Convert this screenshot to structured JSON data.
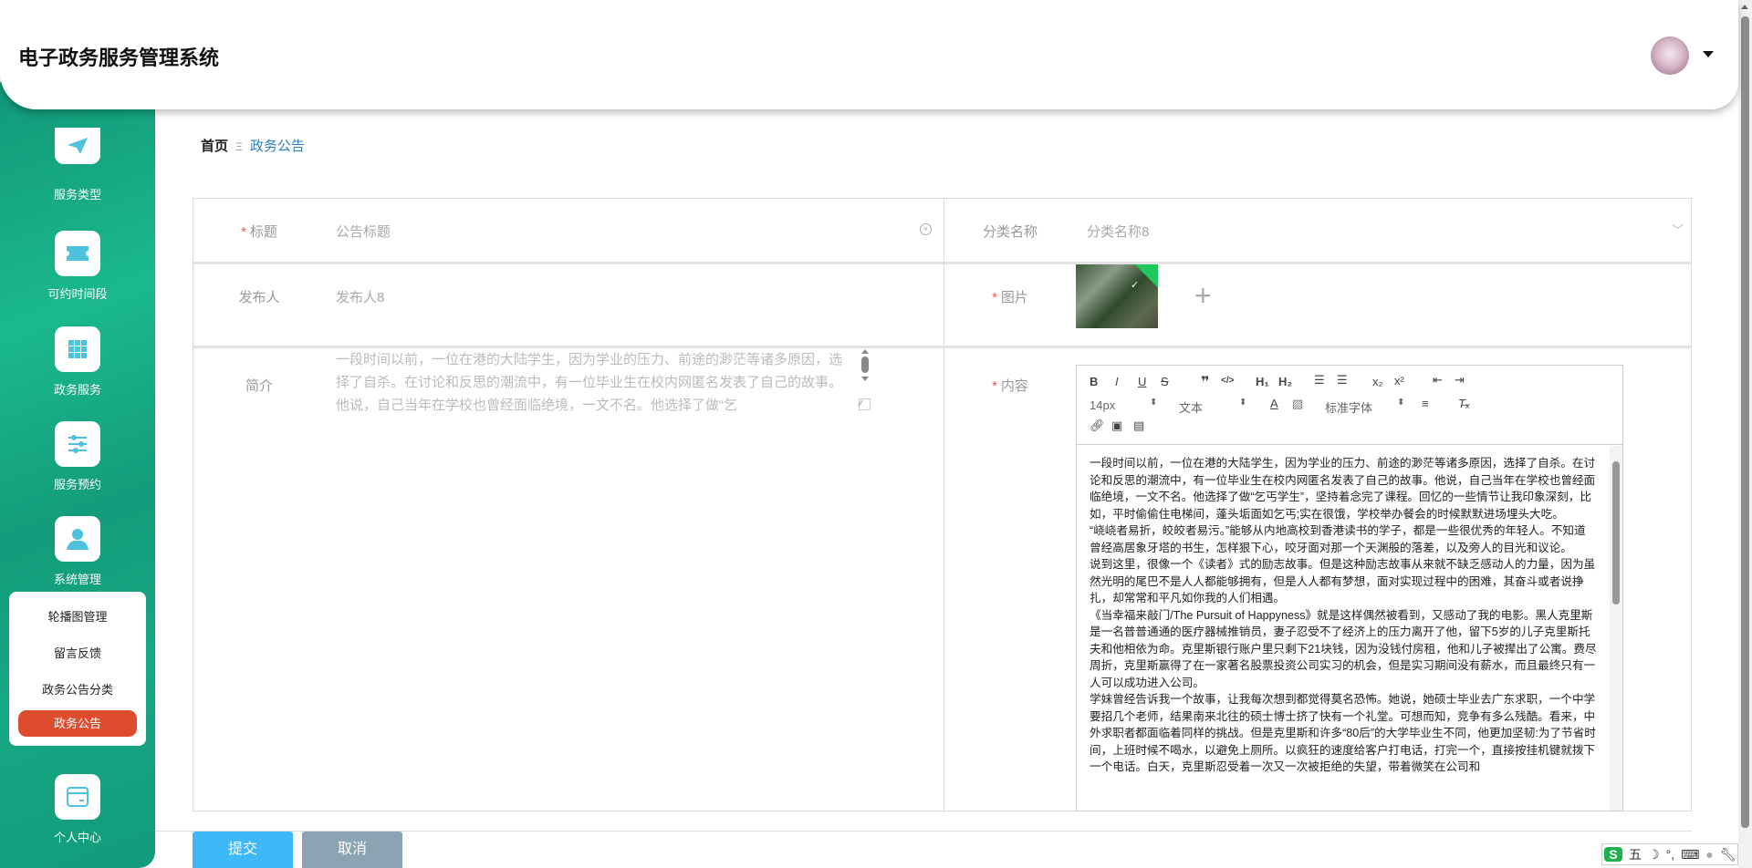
{
  "header": {
    "title": "电子政务服务管理系统"
  },
  "sidebar": {
    "items": [
      {
        "label": "服务类型",
        "icon": "paper-plane-icon"
      },
      {
        "label": "可约时间段",
        "icon": "ticket-icon"
      },
      {
        "label": "政务服务",
        "icon": "grid-icon"
      },
      {
        "label": "服务预约",
        "icon": "sliders-icon"
      },
      {
        "label": "系统管理",
        "icon": "user-icon"
      },
      {
        "label": "个人中心",
        "icon": "card-icon"
      }
    ],
    "submenu": [
      "轮播图管理",
      "留言反馈",
      "政务公告分类",
      "政务公告"
    ]
  },
  "breadcrumb": {
    "home": "首页",
    "sep": "Ξ",
    "current": "政务公告"
  },
  "form": {
    "title_label": "标题",
    "title_placeholder": "公告标题",
    "category_label": "分类名称",
    "category_value": "分类名称8",
    "publisher_label": "发布人",
    "publisher_value": "发布人8",
    "image_label": "图片",
    "intro_label": "简介",
    "intro_value": "一段时间以前，一位在港的大陆学生，因为学业的压力、前途的渺茫等诸多原因，选择了自杀。在讨论和反思的潮流中，有一位毕业生在校内网匿名发表了自己的故事。他说，自己当年在学校也曾经面临绝境，一文不名。他选择了做“乞",
    "content_label": "内容"
  },
  "editor": {
    "font_size": "14px",
    "block": "文本",
    "font": "标准字体",
    "paragraphs": [
      "一段时间以前，一位在港的大陆学生，因为学业的压力、前途的渺茫等诸多原因，选择了自杀。在讨论和反思的潮流中，有一位毕业生在校内网匿名发表了自己的故事。他说，自己当年在学校也曾经面临绝境，一文不名。他选择了做“乞丐学生”，坚持着念完了课程。回忆的一些情节让我印象深刻，比如，平时偷偷住电梯间，蓬头垢面如乞丐;实在很饿，学校举办餐会的时候默默进场埋头大吃。",
      "“峣峣者易折，皎皎者易污。”能够从内地高校到香港读书的学子，都是一些很优秀的年轻人。不知道曾经高居象牙塔的书生，怎样狠下心，咬牙面对那一个天渊般的落差，以及旁人的目光和议论。",
      "说到这里，很像一个《读者》式的励志故事。但是这种励志故事从来就不缺乏感动人的力量，因为虽然光明的尾巴不是人人都能够拥有，但是人人都有梦想，面对实现过程中的困难，其奋斗或者说挣扎，却常常和平凡如你我的人们相遇。",
      "《当幸福来敲门/The Pursuit of Happyness》就是这样偶然被看到，又感动了我的电影。黑人克里斯是一名普普通通的医疗器械推销员，妻子忍受不了经济上的压力离开了他，留下5岁的儿子克里斯托夫和他相依为命。克里斯银行账户里只剩下21块钱，因为没钱付房租，他和儿子被撵出了公寓。费尽周折，克里斯赢得了在一家著名股票投资公司实习的机会，但是实习期间没有薪水，而且最终只有一人可以成功进入公司。",
      "学妹曾经告诉我一个故事，让我每次想到都觉得莫名恐怖。她说，她硕士毕业去广东求职，一个中学要招几个老师，结果南来北往的硕士博士挤了快有一个礼堂。可想而知，竞争有多么残酷。看来，中外求职者都面临着同样的挑战。但是克里斯和许多“80后”的大学毕业生不同，他更加坚韧:为了节省时间，上班时候不喝水，以避免上厕所。以疯狂的速度给客户打电话，打完一个，直接按挂机键就拨下一个电话。白天，克里斯忍受着一次又一次被拒绝的失望，带着微笑在公司和"
    ]
  },
  "actions": {
    "submit": "提交",
    "cancel": "取消"
  },
  "ime": {
    "mode": "五"
  },
  "colors": {
    "sidebar": "#16a884",
    "active": "#dd4c2c",
    "submit": "#3fb8f8",
    "cancel": "#8aa4b4",
    "link": "#2f7fc6"
  }
}
